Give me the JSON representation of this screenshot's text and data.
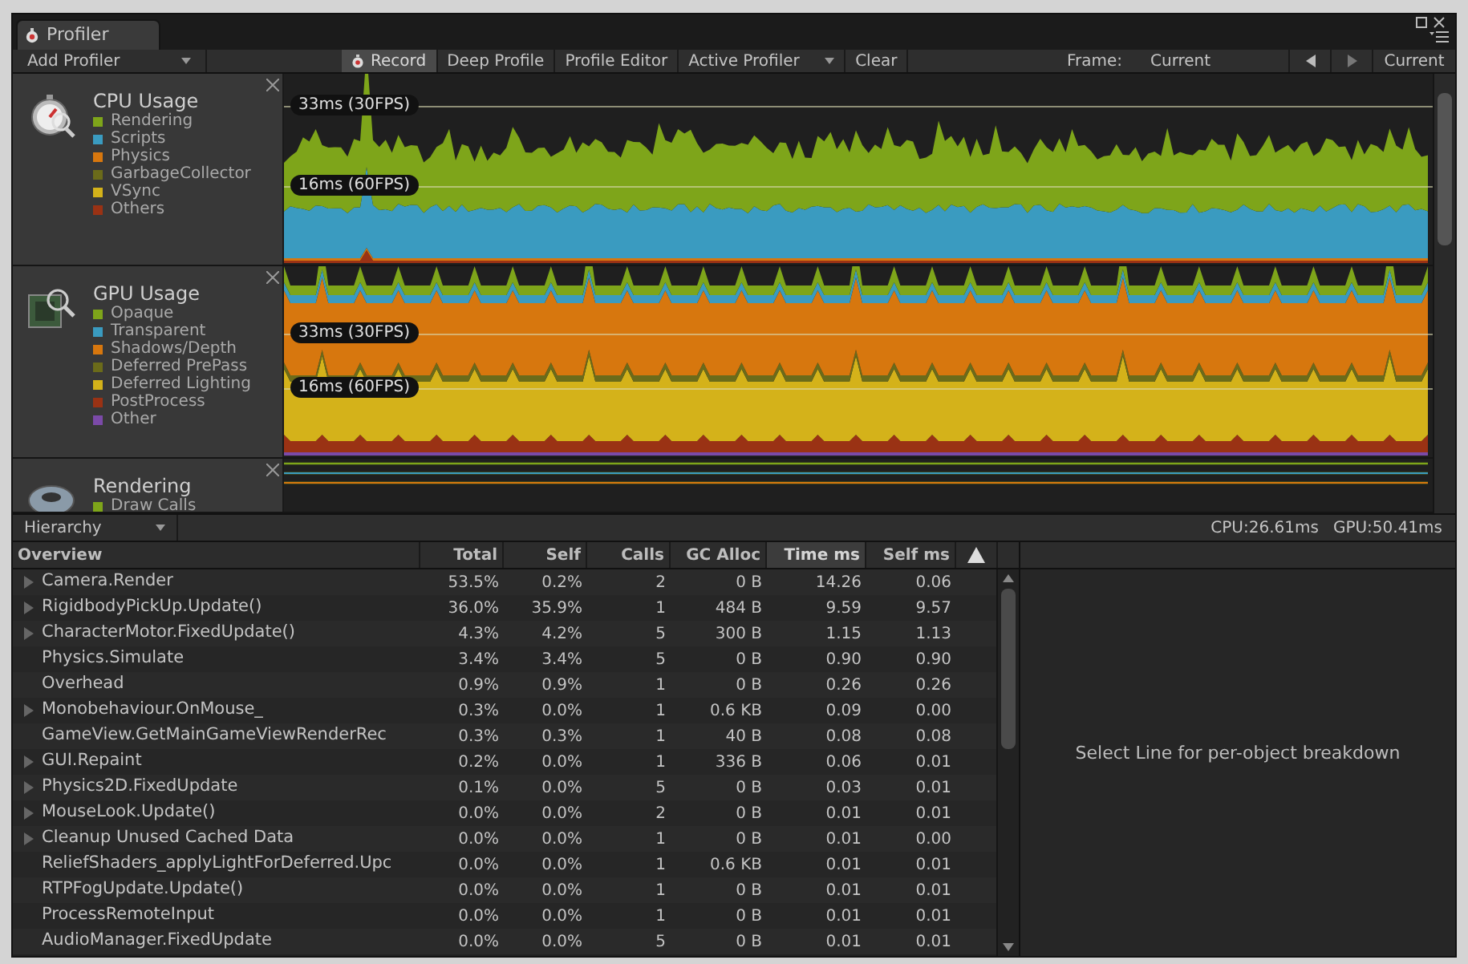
{
  "window": {
    "title": "Profiler"
  },
  "toolbar": {
    "add_profiler": "Add Profiler",
    "buttons": [
      {
        "label": "Record",
        "selected": true,
        "icon": true
      },
      {
        "label": "Deep Profile",
        "selected": false
      },
      {
        "label": "Profile Editor",
        "selected": false
      }
    ],
    "active_profiler": "Active Profiler",
    "clear": "Clear",
    "frame_label": "Frame:",
    "frame_value": "Current",
    "current_button": "Current"
  },
  "modules": [
    {
      "kind": "cpu",
      "title": "CPU Usage",
      "legend": [
        {
          "label": "Rendering",
          "color": "#7ea51a"
        },
        {
          "label": "Scripts",
          "color": "#3a9bc0"
        },
        {
          "label": "Physics",
          "color": "#d7770e"
        },
        {
          "label": "GarbageCollector",
          "color": "#6b6b1a"
        },
        {
          "label": "VSync",
          "color": "#d4b21a"
        },
        {
          "label": "Others",
          "color": "#9a3214"
        }
      ],
      "guides": [
        "33ms (30FPS)",
        "16ms (60FPS)"
      ]
    },
    {
      "kind": "gpu",
      "title": "GPU Usage",
      "legend": [
        {
          "label": "Opaque",
          "color": "#7ea51a"
        },
        {
          "label": "Transparent",
          "color": "#3a9bc0"
        },
        {
          "label": "Shadows/Depth",
          "color": "#d7770e"
        },
        {
          "label": "Deferred PrePass",
          "color": "#6b6b1a"
        },
        {
          "label": "Deferred Lighting",
          "color": "#d4b21a"
        },
        {
          "label": "PostProcess",
          "color": "#9a3214"
        },
        {
          "label": "Other",
          "color": "#7b4aa8"
        }
      ],
      "guides": [
        "33ms (30FPS)",
        "16ms (60FPS)"
      ]
    },
    {
      "kind": "rendering",
      "title": "Rendering",
      "legend": [
        {
          "label": "Draw Calls",
          "color": "#7ea51a"
        }
      ]
    }
  ],
  "hierarchy": {
    "view": "Hierarchy",
    "cpu": "CPU:26.61ms",
    "gpu": "GPU:50.41ms"
  },
  "table": {
    "columns": [
      {
        "label": "Overview",
        "selected": false
      },
      {
        "label": "Total",
        "selected": false
      },
      {
        "label": "Self",
        "selected": false
      },
      {
        "label": "Calls",
        "selected": false
      },
      {
        "label": "GC Alloc",
        "selected": false
      },
      {
        "label": "Time ms",
        "selected": true
      },
      {
        "label": "Self ms",
        "selected": false
      }
    ],
    "rows": [
      {
        "expandable": true,
        "cells": [
          "Camera.Render",
          "53.5%",
          "0.2%",
          "2",
          "0 B",
          "14.26",
          "0.06"
        ]
      },
      {
        "expandable": true,
        "cells": [
          "RigidbodyPickUp.Update()",
          "36.0%",
          "35.9%",
          "1",
          "484 B",
          "9.59",
          "9.57"
        ]
      },
      {
        "expandable": true,
        "cells": [
          "CharacterMotor.FixedUpdate()",
          "4.3%",
          "4.2%",
          "5",
          "300 B",
          "1.15",
          "1.13"
        ]
      },
      {
        "expandable": false,
        "cells": [
          "Physics.Simulate",
          "3.4%",
          "3.4%",
          "5",
          "0 B",
          "0.90",
          "0.90"
        ]
      },
      {
        "expandable": false,
        "cells": [
          "Overhead",
          "0.9%",
          "0.9%",
          "1",
          "0 B",
          "0.26",
          "0.26"
        ]
      },
      {
        "expandable": true,
        "cells": [
          "Monobehaviour.OnMouse_",
          "0.3%",
          "0.0%",
          "1",
          "0.6 KB",
          "0.09",
          "0.00"
        ]
      },
      {
        "expandable": false,
        "cells": [
          "GameView.GetMainGameViewRenderRec",
          "0.3%",
          "0.3%",
          "1",
          "40 B",
          "0.08",
          "0.08"
        ]
      },
      {
        "expandable": true,
        "cells": [
          "GUI.Repaint",
          "0.2%",
          "0.0%",
          "1",
          "336 B",
          "0.06",
          "0.01"
        ]
      },
      {
        "expandable": true,
        "cells": [
          "Physics2D.FixedUpdate",
          "0.1%",
          "0.0%",
          "5",
          "0 B",
          "0.03",
          "0.01"
        ]
      },
      {
        "expandable": true,
        "cells": [
          "MouseLook.Update()",
          "0.0%",
          "0.0%",
          "2",
          "0 B",
          "0.01",
          "0.01"
        ]
      },
      {
        "expandable": true,
        "cells": [
          "Cleanup Unused Cached Data",
          "0.0%",
          "0.0%",
          "1",
          "0 B",
          "0.01",
          "0.00"
        ]
      },
      {
        "expandable": false,
        "cells": [
          "ReliefShaders_applyLightForDeferred.Upc",
          "0.0%",
          "0.0%",
          "1",
          "0.6 KB",
          "0.01",
          "0.01"
        ]
      },
      {
        "expandable": false,
        "cells": [
          "RTPFogUpdate.Update()",
          "0.0%",
          "0.0%",
          "1",
          "0 B",
          "0.01",
          "0.01"
        ]
      },
      {
        "expandable": false,
        "cells": [
          "ProcessRemoteInput",
          "0.0%",
          "0.0%",
          "1",
          "0 B",
          "0.01",
          "0.01"
        ]
      },
      {
        "expandable": false,
        "cells": [
          "AudioManager.FixedUpdate",
          "0.0%",
          "0.0%",
          "5",
          "0 B",
          "0.01",
          "0.01"
        ]
      }
    ]
  },
  "detail": {
    "message": "Select Line for per-object breakdown"
  }
}
